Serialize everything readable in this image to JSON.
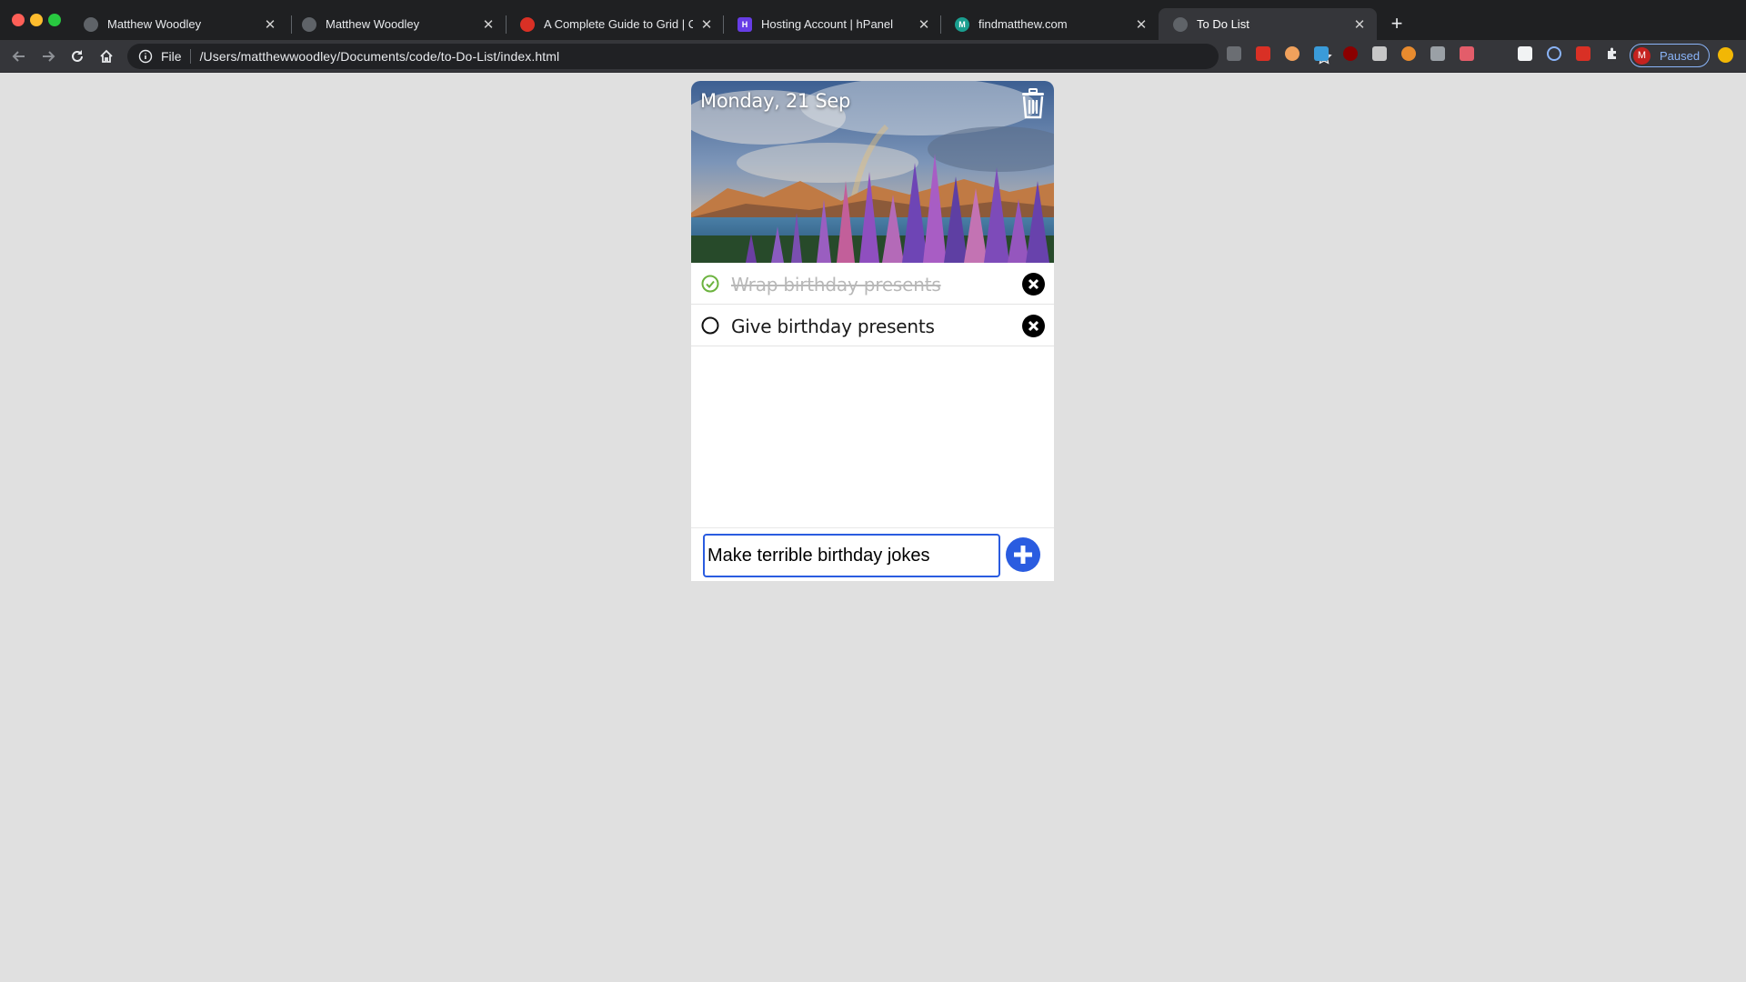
{
  "browser": {
    "tabs": [
      {
        "title": "Matthew Woodley"
      },
      {
        "title": "Matthew Woodley"
      },
      {
        "title": "A Complete Guide to Grid | CSS"
      },
      {
        "title": "Hosting Account | hPanel"
      },
      {
        "title": "findmatthew.com"
      },
      {
        "title": "To Do List"
      }
    ],
    "address": {
      "scheme_label": "File",
      "url": "/Users/matthewwoodley/Documents/code/to-Do-List/index.html"
    },
    "profile": {
      "initial": "M",
      "status": "Paused"
    }
  },
  "app": {
    "date": "Monday, 21 Sep",
    "todos": [
      {
        "text": "Wrap birthday presents",
        "done": true
      },
      {
        "text": "Give birthday presents",
        "done": false
      }
    ],
    "new_todo_value": "Make terrible birthday jokes"
  },
  "colors": {
    "accent": "#2a5ce0",
    "done_check": "#6cb33f"
  }
}
